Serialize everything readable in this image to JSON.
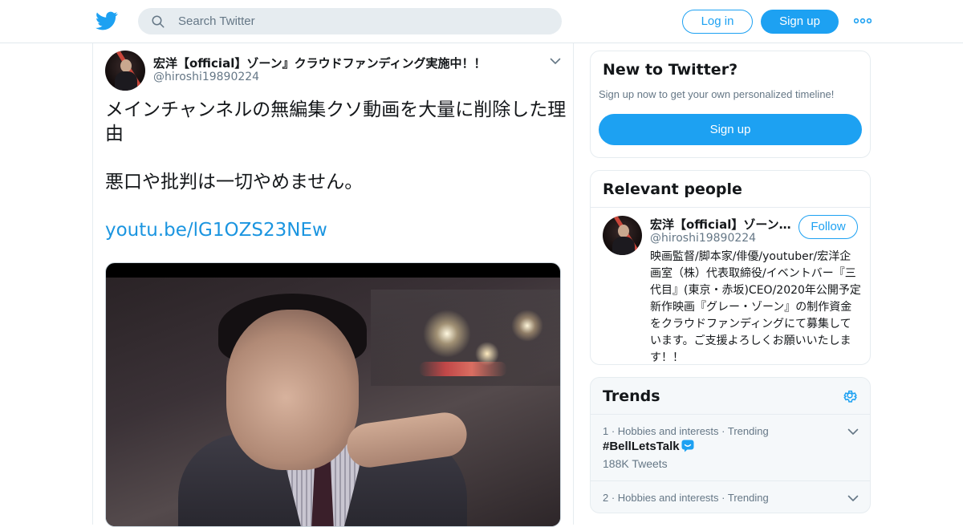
{
  "header": {
    "search_placeholder": "Search Twitter",
    "login_label": "Log in",
    "signup_label": "Sign up"
  },
  "tweet": {
    "author_name": "宏洋【official】ゾーン』クラウドファンディング実施中！！",
    "author_handle": "@hiroshi19890224",
    "text_line1": "メインチャンネルの無編集クソ動画を大量に削除した理由",
    "text_line2": "悪口や批判は一切やめません。",
    "link": "youtu.be/lG1OZS23NEw"
  },
  "new_to_twitter": {
    "title": "New to Twitter?",
    "subtitle": "Sign up now to get your own personalized timeline!",
    "button_label": "Sign up"
  },
  "relevant_people": {
    "title": "Relevant people",
    "person": {
      "name": "宏洋【official】ゾーン』クラウドファンディング実施中！！",
      "handle": "@hiroshi19890224",
      "follow_label": "Follow",
      "bio": "映画監督/脚本家/俳優/youtuber/宏洋企画室（株）代表取締役/イベントバー『三代目』(東京・赤坂)CEO/2020年公開予定新作映画『グレー・ゾーン』の制作資金をクラウドファンディングにて募集しています。ご支援よろしくお願いいたします！！"
    }
  },
  "trends": {
    "title": "Trends",
    "items": [
      {
        "rank": "1",
        "category": "Hobbies and interests",
        "status": "Trending",
        "tag": "#BellLetsTalk",
        "count": "188K Tweets"
      },
      {
        "rank": "2",
        "category": "Hobbies and interests",
        "status": "Trending"
      }
    ]
  },
  "colors": {
    "accent": "#1da1f2",
    "link": "#1b95e0",
    "secondary_text": "#657786",
    "border": "#e6ecf0"
  },
  "icons": [
    "twitter-bird-icon",
    "search-icon",
    "more-dots-icon",
    "chevron-down-icon",
    "gear-icon",
    "speech-bubble-emoji-icon"
  ]
}
